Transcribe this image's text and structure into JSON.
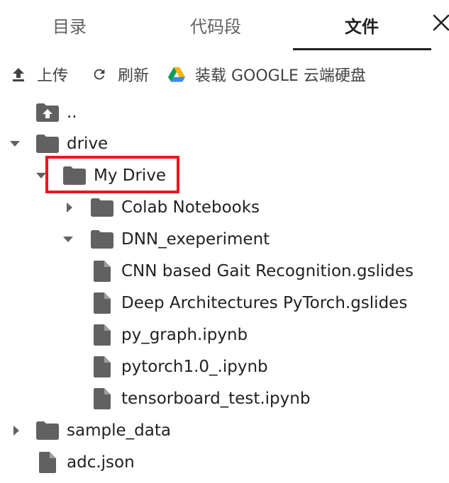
{
  "tabs": {
    "toc": "目录",
    "snippets": "代码段",
    "files": "文件"
  },
  "toolbar": {
    "upload": "上传",
    "refresh": "刷新",
    "mount": "装载 GOOGLE 云端硬盘"
  },
  "tree": {
    "parent": "..",
    "drive": "drive",
    "my_drive": "My Drive",
    "colab_notebooks": "Colab Notebooks",
    "dnn_folder": "DNN_exeperiment",
    "file_cnn": "CNN based Gait Recognition.gslides",
    "file_deep": "Deep Architectures PyTorch.gslides",
    "file_pygraph": "py_graph.ipynb",
    "file_pytorch": "pytorch1.0_.ipynb",
    "file_tensorboard": "tensorboard_test.ipynb",
    "sample_data": "sample_data",
    "adc": "adc.json"
  },
  "colors": {
    "icon_gray": "#616161",
    "highlight_red": "#e8161f",
    "drive_green": "#0f9d58",
    "drive_yellow": "#f4b400",
    "drive_blue": "#4285f4"
  }
}
